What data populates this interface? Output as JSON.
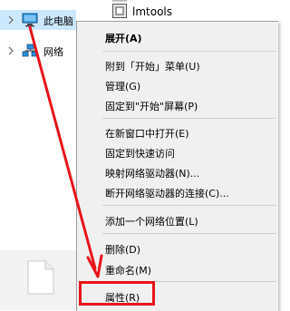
{
  "nav": {
    "items": [
      {
        "label": "此电脑",
        "icon": "computer-icon"
      },
      {
        "label": "网络",
        "icon": "network-icon"
      }
    ]
  },
  "file_list": {
    "items": [
      {
        "label": "lmtools",
        "icon": "app-icon"
      }
    ]
  },
  "context_menu": {
    "items": [
      {
        "label": "展开(A)"
      },
      {
        "label": "附到「开始」菜单(U)"
      },
      {
        "label": "管理(G)"
      },
      {
        "label": "固定到\"开始\"屏幕(P)"
      },
      {
        "label": "在新窗口中打开(E)"
      },
      {
        "label": "固定到快速访问"
      },
      {
        "label": "映射网络驱动器(N)..."
      },
      {
        "label": "断开网络驱动器的连接(C)..."
      },
      {
        "label": "添加一个网络位置(L)"
      },
      {
        "label": "删除(D)"
      },
      {
        "label": "重命名(M)"
      },
      {
        "label": "属性(R)"
      }
    ]
  },
  "colors": {
    "annotation": "#e8141a",
    "nav_selected": "#cce8ff",
    "menu_bg": "#f0f0f0"
  }
}
